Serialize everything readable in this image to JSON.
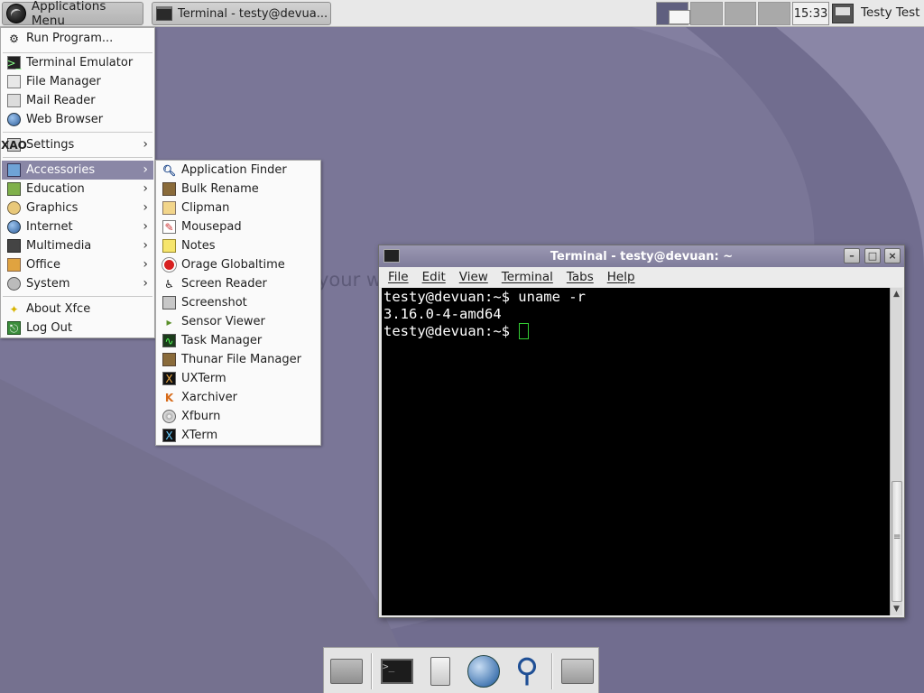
{
  "desktop": {
    "watermark": "your w"
  },
  "top_panel": {
    "apps_menu_label": "Applications Menu",
    "task_button_label": "Terminal - testy@devua...",
    "clock": "15:33",
    "user_name": "Testy Test",
    "workspaces": [
      {
        "active": true
      },
      {
        "active": false
      },
      {
        "active": false
      },
      {
        "active": false
      }
    ]
  },
  "main_menu": {
    "items": [
      {
        "label": "Run Program...",
        "icon": "run-icon"
      },
      {
        "label": "Terminal Emulator",
        "icon": "terminal-icon"
      },
      {
        "label": "File Manager",
        "icon": "file-manager-icon"
      },
      {
        "label": "Mail Reader",
        "icon": "mail-icon"
      },
      {
        "label": "Web Browser",
        "icon": "globe-icon"
      },
      {
        "label": "Settings",
        "icon": "settings-icon"
      },
      {
        "label": "Accessories",
        "icon": "accessories-icon"
      },
      {
        "label": "Education",
        "icon": "education-icon"
      },
      {
        "label": "Graphics",
        "icon": "graphics-icon"
      },
      {
        "label": "Internet",
        "icon": "internet-icon"
      },
      {
        "label": "Multimedia",
        "icon": "multimedia-icon"
      },
      {
        "label": "Office",
        "icon": "office-icon"
      },
      {
        "label": "System",
        "icon": "system-icon"
      },
      {
        "label": "About Xfce",
        "icon": "star-icon"
      },
      {
        "label": "Log Out",
        "icon": "logout-icon"
      }
    ],
    "selected": "Accessories"
  },
  "accessories_menu": {
    "items": [
      {
        "label": "Application Finder",
        "icon": "magnifier-icon"
      },
      {
        "label": "Bulk Rename",
        "icon": "brush-icon"
      },
      {
        "label": "Clipman",
        "icon": "clipboard-icon"
      },
      {
        "label": "Mousepad",
        "icon": "notepad-icon"
      },
      {
        "label": "Notes",
        "icon": "notes-icon"
      },
      {
        "label": "Orage Globaltime",
        "icon": "clock-icon"
      },
      {
        "label": "Screen Reader",
        "icon": "screen-reader-icon"
      },
      {
        "label": "Screenshot",
        "icon": "screenshot-icon"
      },
      {
        "label": "Sensor Viewer",
        "icon": "sensor-icon"
      },
      {
        "label": "Task Manager",
        "icon": "task-manager-icon"
      },
      {
        "label": "Thunar File Manager",
        "icon": "thunar-icon"
      },
      {
        "label": "UXTerm",
        "icon": "uxterm-icon"
      },
      {
        "label": "Xarchiver",
        "icon": "archive-icon"
      },
      {
        "label": "Xfburn",
        "icon": "disc-icon"
      },
      {
        "label": "XTerm",
        "icon": "xterm-icon"
      }
    ]
  },
  "terminal": {
    "title": "Terminal - testy@devuan: ~",
    "menu": [
      "File",
      "Edit",
      "View",
      "Terminal",
      "Tabs",
      "Help"
    ],
    "lines": [
      "testy@devuan:~$ uname -r",
      "3.16.0-4-amd64",
      "testy@devuan:~$ "
    ],
    "controls": {
      "minimize": "–",
      "maximize": "□",
      "close": "×"
    }
  },
  "colors": {
    "desktop_bg": "#7a7697",
    "menu_selected": "#8a87a6",
    "titlebar": "#8e8baa"
  }
}
